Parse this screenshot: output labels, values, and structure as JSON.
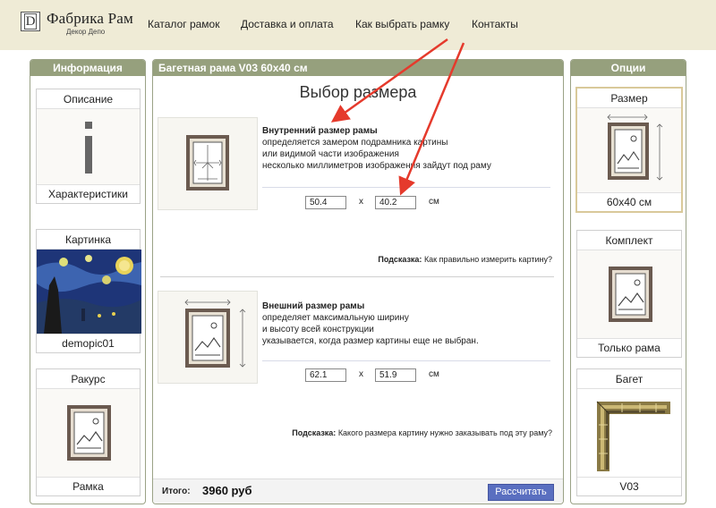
{
  "header": {
    "logo_letter": "D",
    "brand": "Фабрика Рам",
    "brand_sub": "Декор Депо",
    "nav": [
      "Каталог рамок",
      "Доставка и оплата",
      "Как выбрать рамку",
      "Контакты"
    ]
  },
  "left": {
    "title": "Информация",
    "cards": [
      {
        "head": "Описание",
        "icon": "info-icon",
        "foot": "Характеристики"
      },
      {
        "head": "Картинка",
        "icon": "starry-night-thumbnail",
        "foot": "demopic01"
      },
      {
        "head": "Ракурс",
        "icon": "frame-picture-icon",
        "foot": "Рамка"
      }
    ]
  },
  "middle": {
    "title": "Багетная рама V03 60x40 см",
    "heading": "Выбор размера",
    "inner": {
      "title": "Внутренний размер рамы",
      "lines": [
        "определяется замером подрамника картины",
        "или видимой части изображения",
        "несколько миллиметров изображения зайдут под раму"
      ],
      "width": "50.4",
      "height": "40.2",
      "x": "x",
      "unit": "см",
      "hint_label": "Подсказка:",
      "hint_text": " Как правильно измерить картину?"
    },
    "outer": {
      "title": "Внешний размер рамы",
      "lines": [
        "определяет максимальную ширину",
        "и высоту всей конструкции",
        "указывается, когда размер картины еще не выбран."
      ],
      "width": "62.1",
      "height": "51.9",
      "x": "x",
      "unit": "см",
      "hint_label": "Подсказка:",
      "hint_text": " Какого размера картину нужно заказывать под эту раму?"
    },
    "total_label": "Итого:",
    "total_value": "3960 руб",
    "calc_button": "Рассчитать"
  },
  "right": {
    "title": "Опции",
    "cards": [
      {
        "head": "Размер",
        "icon": "size-frame-icon",
        "foot": "60x40 см",
        "selected": true
      },
      {
        "head": "Комплект",
        "icon": "frame-picture-icon",
        "foot": "Только рама"
      },
      {
        "head": "Багет",
        "icon": "baguette-corner-image",
        "foot": "V03"
      }
    ]
  },
  "colors": {
    "header_bg": "#efebd6",
    "panel_title_bg": "#96a07d",
    "arrow": "#e53a2c",
    "button": "#5a6fc0"
  }
}
